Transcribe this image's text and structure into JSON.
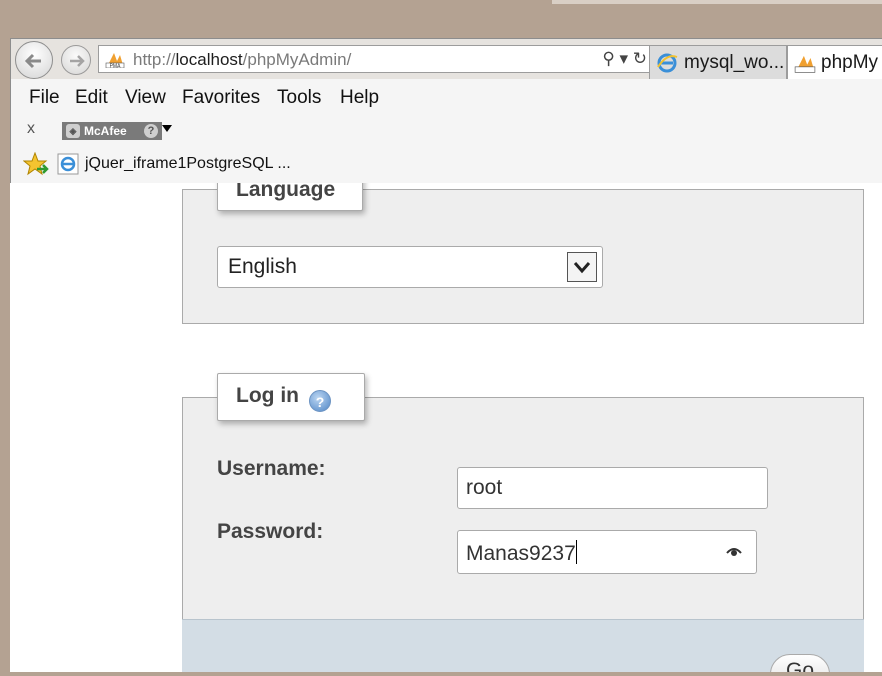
{
  "browser": {
    "url_prefix": "http://",
    "url_host": "localhost",
    "url_path": "/phpMyAdmin/",
    "address_tools": "⚲ ▾ ↻",
    "tabs": [
      {
        "label": "mysql_wo..."
      },
      {
        "label": "phpMy"
      }
    ],
    "menu": [
      "File",
      "Edit",
      "View",
      "Favorites",
      "Tools",
      "Help"
    ],
    "command_bar": {
      "close": "x",
      "addon": "McAfee"
    },
    "favorites": {
      "link": "jQuer_iframe1PostgreSQL ..."
    }
  },
  "language": {
    "legend": "Language",
    "selected": "English"
  },
  "login": {
    "legend": "Log in",
    "help_glyph": "?",
    "username_label": "Username:",
    "username_value": "root",
    "password_label": "Password:",
    "password_value": "Manas9237",
    "go_label": "Go"
  },
  "colors": {
    "fieldset_bg": "#eeeeee",
    "bottom_bar": "#d3dde5",
    "desktop": "#b4a292"
  }
}
